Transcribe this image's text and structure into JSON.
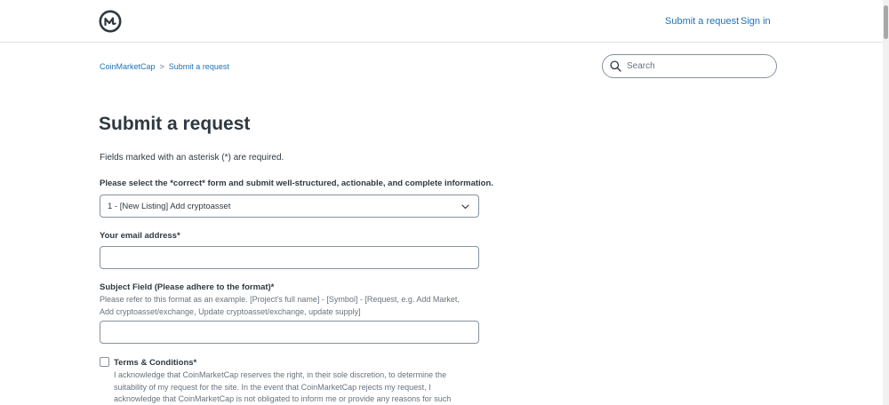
{
  "header": {
    "logo_name": "coinmarketcap-logo",
    "nav": {
      "submit_request": "Submit a request",
      "sign_in": "Sign in"
    }
  },
  "breadcrumb": {
    "items": [
      "CoinMarketCap",
      "Submit a request"
    ],
    "separator": ">"
  },
  "search": {
    "placeholder": "Search"
  },
  "page": {
    "title": "Submit a request",
    "required_note": "Fields marked with an asterisk (*) are required."
  },
  "form": {
    "form_select": {
      "label": "Please select the *correct* form and submit well-structured, actionable, and complete information.",
      "value": "1 - [New Listing] Add cryptoasset"
    },
    "email": {
      "label": "Your email address*",
      "value": ""
    },
    "subject": {
      "label": "Subject Field (Please adhere to the format)*",
      "hint": "Please refer to this format as an example. [Project's full name] - [Symbol] - [Request, e.g. Add Market, Add cryptoasset/exchange, Update cryptoasset/exchange, update supply]",
      "value": ""
    },
    "terms": {
      "label": "Terms & Conditions*",
      "checked": false,
      "text": "I acknowledge that CoinMarketCap reserves the right, in their sole discretion, to determine the suitability of my request for the site. In the event that CoinMarketCap rejects my request, I acknowledge that CoinMarketCap is not obligated to inform me or provide any reasons for such"
    }
  },
  "colors": {
    "link": "#1f73b7",
    "text": "#2f3941",
    "muted": "#68737d",
    "border": "#87929d"
  }
}
